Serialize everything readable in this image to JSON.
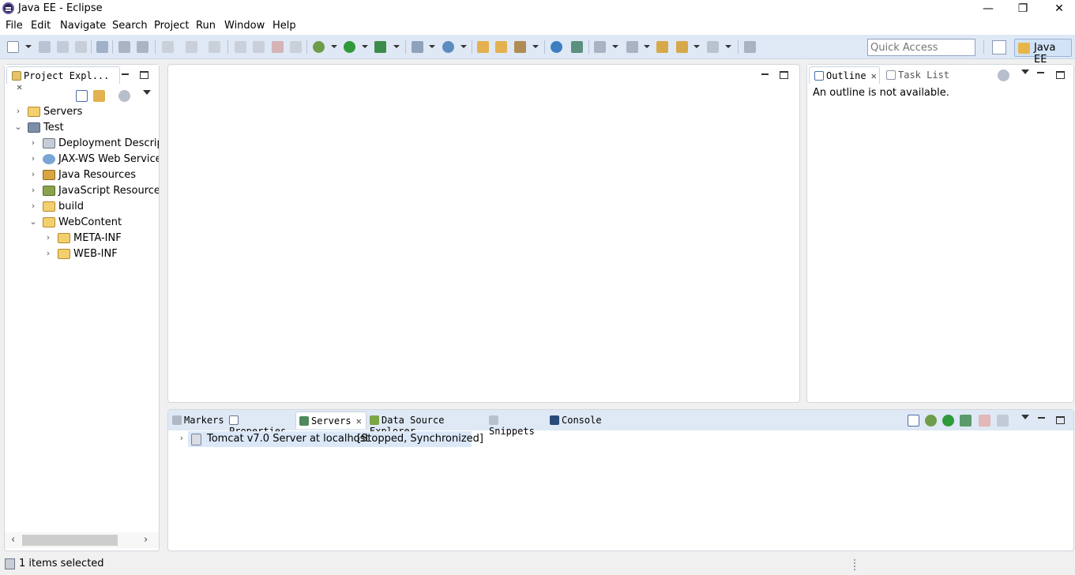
{
  "window": {
    "title": "Java EE - Eclipse",
    "minimize": "—",
    "restore": "❐",
    "close": "✕"
  },
  "menu": [
    {
      "label": "File"
    },
    {
      "label": "Edit"
    },
    {
      "label": "Navigate"
    },
    {
      "label": "Search"
    },
    {
      "label": "Project"
    },
    {
      "label": "Run"
    },
    {
      "label": "Window"
    },
    {
      "label": "Help"
    }
  ],
  "toolbar": {
    "quick_access_placeholder": "Quick Access",
    "perspective_label": "Java EE"
  },
  "project_explorer": {
    "tab_label": "Project Expl...",
    "items": [
      {
        "label": "Servers",
        "expanded": false,
        "icon": "servers-folder-icon"
      },
      {
        "label": "Test",
        "expanded": true,
        "icon": "web-project-icon"
      },
      {
        "label": "Deployment Descript",
        "expanded": false,
        "icon": "deployment-descriptor-icon"
      },
      {
        "label": "JAX-WS Web Service",
        "expanded": false,
        "icon": "web-service-icon"
      },
      {
        "label": "Java Resources",
        "expanded": false,
        "icon": "java-resources-icon"
      },
      {
        "label": "JavaScript Resources",
        "expanded": false,
        "icon": "javascript-resources-icon"
      },
      {
        "label": "build",
        "expanded": false,
        "icon": "folder-icon"
      },
      {
        "label": "WebContent",
        "expanded": true,
        "icon": "folder-open-icon"
      },
      {
        "label": "META-INF",
        "expanded": false,
        "icon": "folder-icon"
      },
      {
        "label": "WEB-INF",
        "expanded": false,
        "icon": "folder-icon"
      }
    ]
  },
  "outline": {
    "tab_label": "Outline",
    "task_list_label": "Task List",
    "message": "An outline is not available."
  },
  "bottom_panel": {
    "tabs": [
      {
        "label": "Markers"
      },
      {
        "label": "Properties"
      },
      {
        "label": "Servers"
      },
      {
        "label": "Data Source Explorer"
      },
      {
        "label": "Snippets"
      },
      {
        "label": "Console"
      }
    ],
    "server_row": {
      "name": "Tomcat v7.0 Server at localhost",
      "state": "[Stopped, Synchronized]"
    }
  },
  "status": {
    "text": "1 items selected"
  },
  "tree_twisty": {
    "collapsed": "›",
    "expanded": "⌄"
  },
  "scroll_arrows": {
    "left": "‹",
    "right": "›"
  }
}
